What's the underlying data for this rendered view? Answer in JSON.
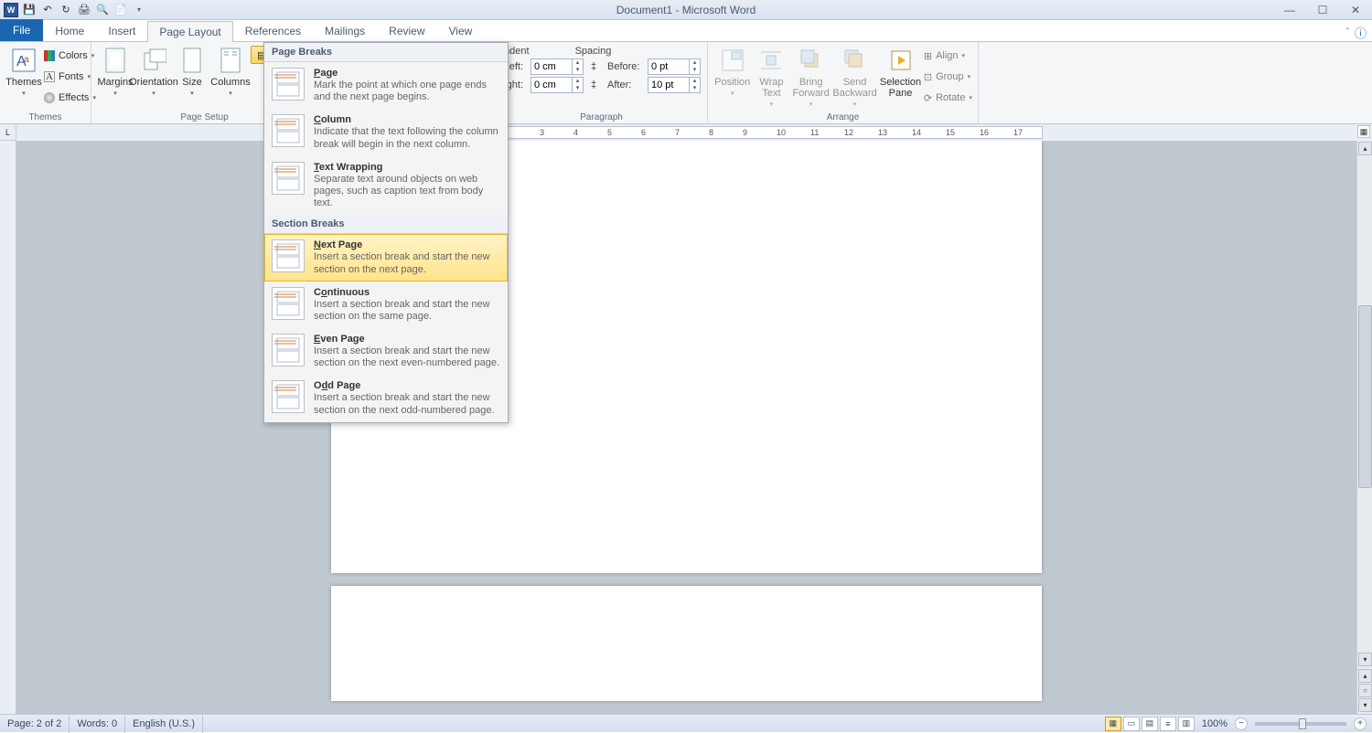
{
  "title": "Document1 - Microsoft Word",
  "tabs": {
    "file": "File",
    "items": [
      "Home",
      "Insert",
      "Page Layout",
      "References",
      "Mailings",
      "Review",
      "View"
    ],
    "active_index": 2
  },
  "ribbon": {
    "themes": {
      "label": "Themes",
      "themes_btn": "Themes",
      "colors": "Colors",
      "fonts": "Fonts",
      "effects": "Effects"
    },
    "page_setup": {
      "label": "Page Setup",
      "margins": "Margins",
      "orientation": "Orientation",
      "size": "Size",
      "columns": "Columns",
      "breaks": "Breaks"
    },
    "paragraph": {
      "label": "Paragraph",
      "indent": "Indent",
      "spacing": "Spacing",
      "left": "Left:",
      "right": "Right:",
      "before": "Before:",
      "after": "After:",
      "left_val": "0 cm",
      "right_val": "0 cm",
      "before_val": "0 pt",
      "after_val": "10 pt"
    },
    "arrange": {
      "label": "Arrange",
      "position": "Position",
      "wrap": "Wrap\nText",
      "bring": "Bring\nForward",
      "send": "Send\nBackward",
      "selection": "Selection\nPane",
      "align": "Align",
      "group": "Group",
      "rotate": "Rotate"
    }
  },
  "breaks_panel": {
    "page_breaks_header": "Page Breaks",
    "section_breaks_header": "Section Breaks",
    "items": [
      {
        "title": "Page",
        "underline": "P",
        "rest": "age",
        "desc": "Mark the point at which one page ends and the next page begins."
      },
      {
        "title": "Column",
        "underline": "C",
        "rest": "olumn",
        "desc": "Indicate that the text following the column break will begin in the next column."
      },
      {
        "title": "Text Wrapping",
        "underline": "T",
        "rest": "ext Wrapping",
        "desc": "Separate text around objects on web pages, such as caption text from body text."
      }
    ],
    "section_items": [
      {
        "title": "Next Page",
        "underline": "N",
        "rest": "ext Page",
        "desc": "Insert a section break and start the new section on the next page.",
        "hover": true
      },
      {
        "title": "Continuous",
        "underline": "o",
        "pre": "C",
        "rest": "ntinuous",
        "desc": "Insert a section break and start the new section on the same page."
      },
      {
        "title": "Even Page",
        "underline": "E",
        "rest": "ven Page",
        "desc": "Insert a section break and start the new section on the next even-numbered page."
      },
      {
        "title": "Odd Page",
        "underline": "d",
        "pre": "O",
        "rest": "d Page",
        "desc": "Insert a section break and start the new section on the next odd-numbered page."
      }
    ]
  },
  "ruler_ticks": [
    "3",
    "4",
    "5",
    "6",
    "7",
    "8",
    "9",
    "10",
    "11",
    "12",
    "13",
    "14",
    "15",
    "16",
    "17"
  ],
  "statusbar": {
    "page": "Page: 2 of 2",
    "words": "Words: 0",
    "lang": "English (U.S.)",
    "zoom": "100%"
  }
}
